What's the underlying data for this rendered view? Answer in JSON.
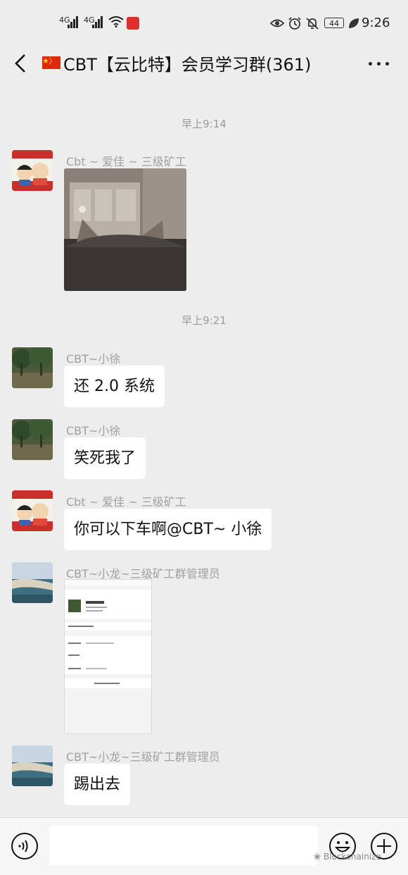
{
  "status_bar": {
    "sim1": "4G",
    "sim2": "4G",
    "battery": "44",
    "time": "9:26"
  },
  "header": {
    "title": "CBT【云比特】会员学习群(361)"
  },
  "messages": [
    {
      "kind": "timestamp",
      "text": "早上9:14"
    },
    {
      "kind": "image",
      "sender": "Cbt ~ 爱佳 ~ 三级矿工"
    },
    {
      "kind": "timestamp",
      "text": "早上9:21"
    },
    {
      "kind": "text",
      "sender": "CBT~小徐",
      "text": "还 2.0 系统"
    },
    {
      "kind": "text",
      "sender": "CBT~小徐",
      "text": "笑死我了"
    },
    {
      "kind": "text",
      "sender": "Cbt ~ 爱佳 ~ 三级矿工",
      "text": "你可以下车啊@CBT~ 小徐"
    },
    {
      "kind": "image",
      "sender": "CBT~小龙~三级矿工群管理员"
    },
    {
      "kind": "text",
      "sender": "CBT~小龙~三级矿工群管理员",
      "text": "踢出去"
    }
  ],
  "watermark": "Blockchainize"
}
